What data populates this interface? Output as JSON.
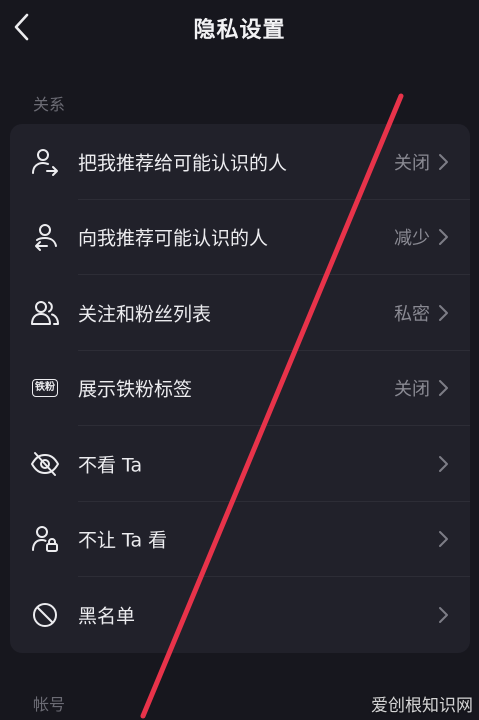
{
  "header": {
    "title": "隐私设置",
    "back_icon": "chevron-left-icon"
  },
  "sections": {
    "relations_label": "关系",
    "account_label": "帐号"
  },
  "rows": [
    {
      "name": "recommend-me-to-acquaintances",
      "icon": "user-share-icon",
      "label": "把我推荐给可能认识的人",
      "value": "关闭"
    },
    {
      "name": "recommend-acquaintances-to-me",
      "icon": "user-incoming-icon",
      "label": "向我推荐可能认识的人",
      "value": "减少"
    },
    {
      "name": "following-and-fans-list",
      "icon": "users-icon",
      "label": "关注和粉丝列表",
      "value": "私密"
    },
    {
      "name": "show-iron-fan-badge",
      "icon": "iron-fan-badge-icon",
      "label": "展示铁粉标签",
      "value": "关闭",
      "badge_text": "铁粉"
    },
    {
      "name": "dont-watch-them",
      "icon": "eye-off-icon",
      "label": "不看 Ta",
      "value": ""
    },
    {
      "name": "dont-let-them-watch",
      "icon": "user-lock-icon",
      "label": "不让 Ta 看",
      "value": ""
    },
    {
      "name": "blacklist",
      "icon": "block-icon",
      "label": "黑名单",
      "value": ""
    }
  ],
  "watermark": "爱创根知识网",
  "colors": {
    "background": "#17171e",
    "card": "#21212a",
    "annotation_line": "#e8334a"
  }
}
